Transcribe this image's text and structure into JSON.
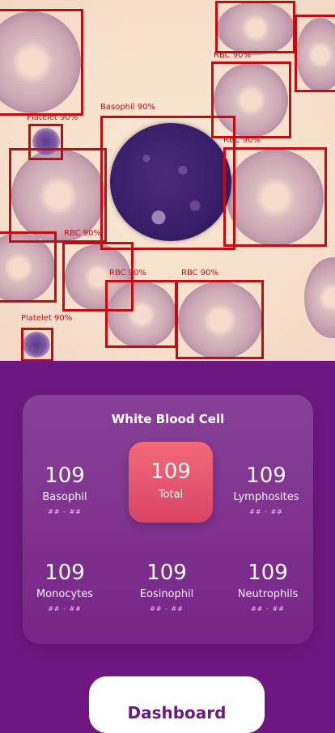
{
  "detections": [
    {
      "label": "Basophil 90%"
    },
    {
      "label": "Platelet 90%"
    },
    {
      "label": "RBC 90%"
    },
    {
      "label": "RBC 90%"
    },
    {
      "label": "RBC 90%"
    },
    {
      "label": "RBC 90%"
    },
    {
      "label": "RBC 90%"
    },
    {
      "label": "Platelet 90%"
    }
  ],
  "wbc": {
    "title": "White Blood Cell",
    "total": {
      "value": "109",
      "label": "Total"
    },
    "stats": [
      {
        "value": "109",
        "label": "Basophil",
        "range": "## - ##"
      },
      {
        "value": "109",
        "label": "Lymphosites",
        "range": "## - ##"
      },
      {
        "value": "109",
        "label": "Monocytes",
        "range": "## - ##"
      },
      {
        "value": "109",
        "label": "Eosinophil",
        "range": "## - ##"
      },
      {
        "value": "109",
        "label": "Neutrophils",
        "range": "## - ##"
      }
    ]
  },
  "nav": {
    "dashboard": "Dashboard"
  },
  "colors": {
    "box": "#c00d13",
    "background": "#6e1780",
    "total_tile": "#e35570"
  }
}
